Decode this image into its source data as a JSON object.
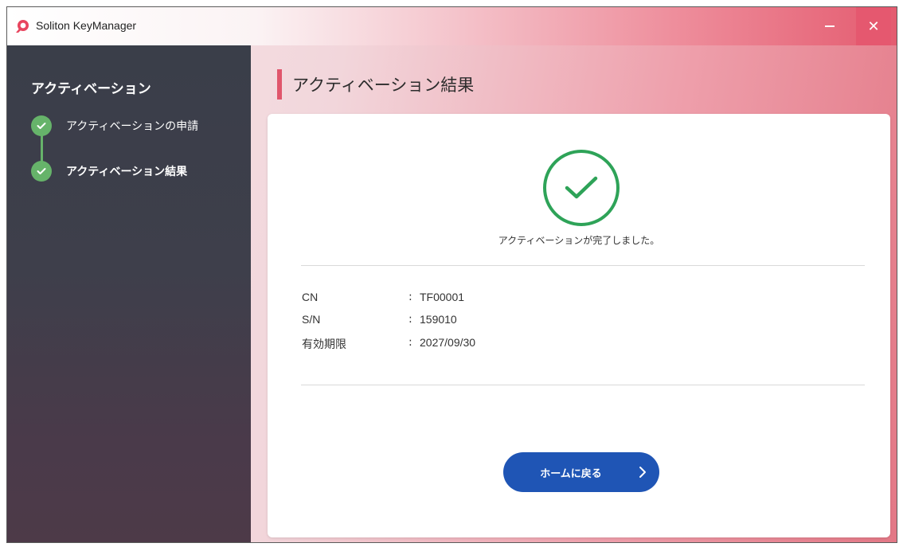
{
  "window": {
    "title": "Soliton KeyManager",
    "icon": "soliton-logo-icon",
    "minimize_icon": "minimize-icon",
    "close_label": "✕"
  },
  "sidebar": {
    "title": "アクティベーション",
    "steps": [
      {
        "label": "アクティベーションの申請",
        "status": "done"
      },
      {
        "label": "アクティベーション結果",
        "status": "done",
        "current": true
      }
    ]
  },
  "main": {
    "title": "アクティベーション結果",
    "success_message": "アクティベーションが完了しました。",
    "info": [
      {
        "key": "CN",
        "sep": ":",
        "value": "TF00001"
      },
      {
        "key": "S/N",
        "sep": ":",
        "value": "159010"
      },
      {
        "key": "有効期限",
        "sep": ":",
        "value": "2027/09/30"
      }
    ],
    "home_button_label": "ホームに戻る"
  },
  "colors": {
    "accent_red": "#e0566c",
    "success_green": "#2ea358",
    "step_green": "#66b36a",
    "button_blue": "#1f55b5",
    "sidebar_dark": "#3d3f4b"
  }
}
